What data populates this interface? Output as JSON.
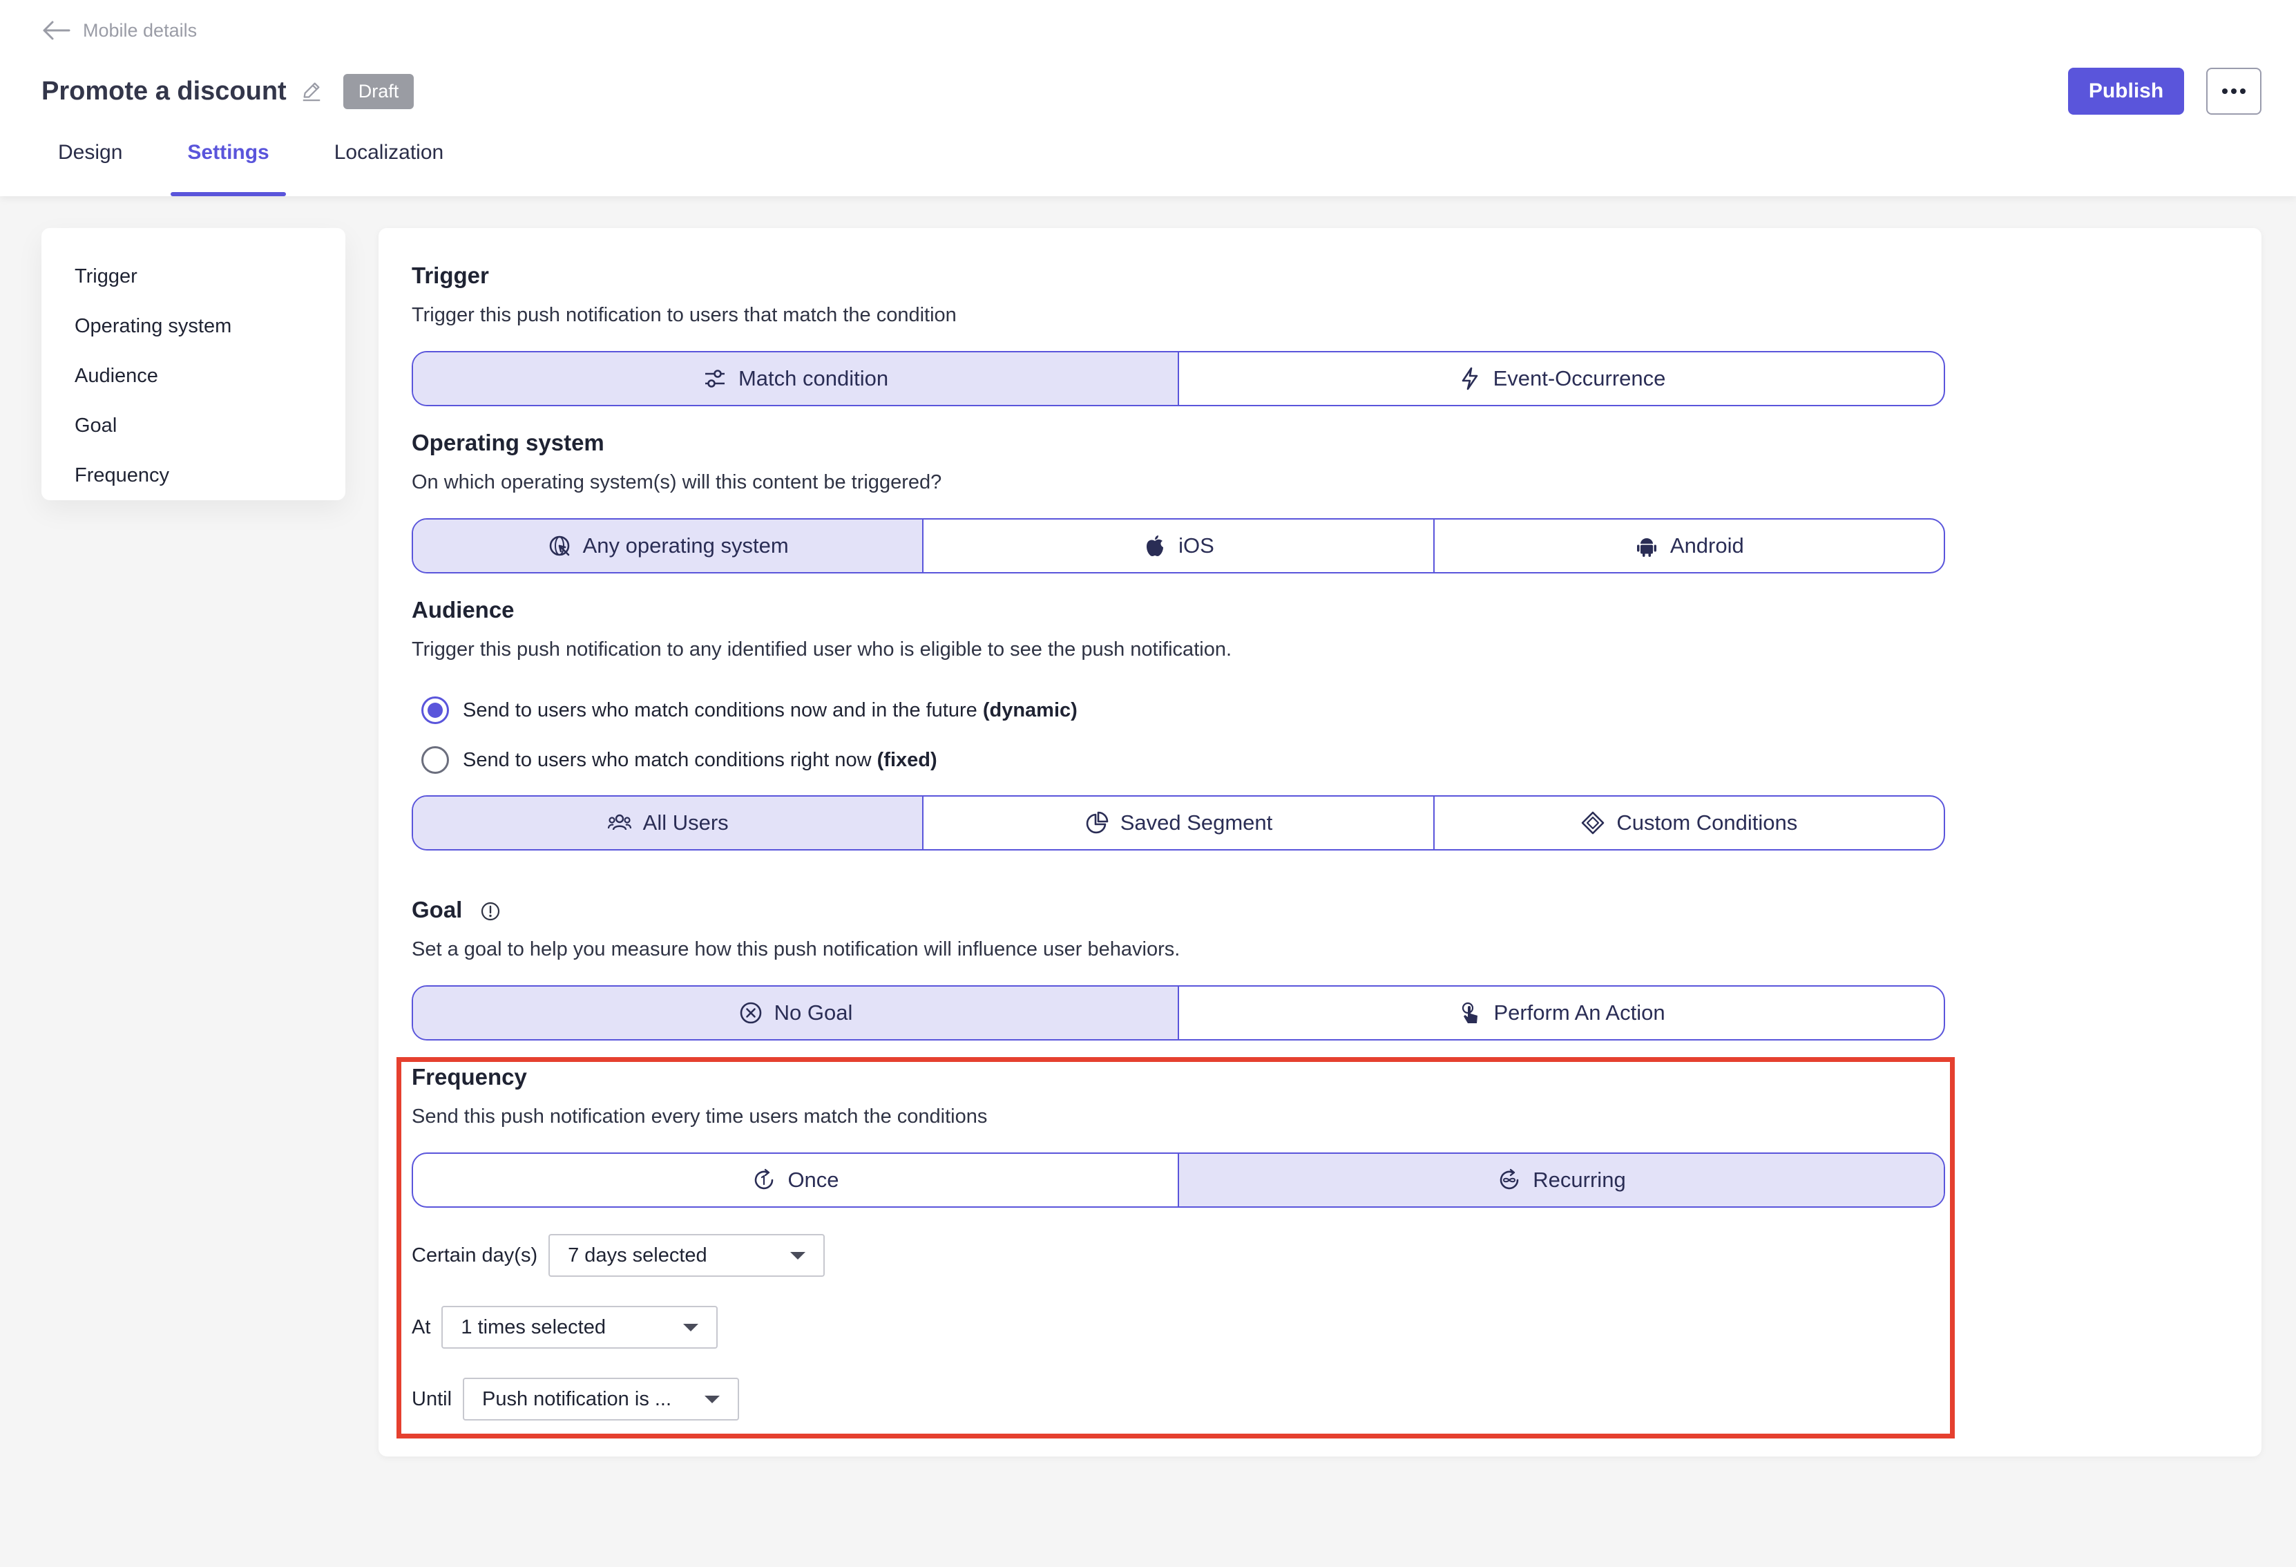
{
  "header": {
    "back_label": "Mobile details",
    "title": "Promote a discount",
    "status_badge": "Draft",
    "publish_label": "Publish",
    "more_icon": "more-horizontal-icon"
  },
  "tabs": [
    {
      "label": "Design",
      "active": false
    },
    {
      "label": "Settings",
      "active": true
    },
    {
      "label": "Localization",
      "active": false
    }
  ],
  "sidenav": {
    "items": [
      "Trigger",
      "Operating system",
      "Audience",
      "Goal",
      "Frequency"
    ]
  },
  "trigger": {
    "title": "Trigger",
    "description": "Trigger this push notification to users that match the condition",
    "options": [
      {
        "label": "Match condition",
        "icon": "sliders-icon",
        "selected": true
      },
      {
        "label": "Event-Occurrence",
        "icon": "lightning-icon",
        "selected": false
      }
    ]
  },
  "os": {
    "title": "Operating system",
    "description": "On which operating system(s) will this content be triggered?",
    "options": [
      {
        "label": "Any operating system",
        "icon": "globe-pointer-icon",
        "selected": true
      },
      {
        "label": "iOS",
        "icon": "apple-icon",
        "selected": false
      },
      {
        "label": "Android",
        "icon": "android-icon",
        "selected": false
      }
    ]
  },
  "audience": {
    "title": "Audience",
    "description": "Trigger this push notification to any identified user who is eligible to see the push notification.",
    "radio_dynamic": {
      "text": "Send to users who match conditions now and in the future ",
      "bold": "(dynamic)",
      "checked": true
    },
    "radio_fixed": {
      "text": "Send to users who match conditions right now ",
      "bold": "(fixed)",
      "checked": false
    },
    "options": [
      {
        "label": "All Users",
        "icon": "users-icon",
        "selected": true
      },
      {
        "label": "Saved Segment",
        "icon": "pie-chart-icon",
        "selected": false
      },
      {
        "label": "Custom Conditions",
        "icon": "diamond-icon",
        "selected": false
      }
    ]
  },
  "goal": {
    "title": "Goal",
    "info_icon": "info-icon",
    "description": "Set a goal to help you measure how this push notification will influence user behaviors.",
    "options": [
      {
        "label": "No Goal",
        "icon": "x-circle-icon",
        "selected": true
      },
      {
        "label": "Perform An Action",
        "icon": "tap-icon",
        "selected": false
      }
    ]
  },
  "frequency": {
    "title": "Frequency",
    "description": "Send this push notification every time users match the conditions",
    "options": [
      {
        "label": "Once",
        "icon": "once-icon",
        "selected": false
      },
      {
        "label": "Recurring",
        "icon": "recurring-icon",
        "selected": true
      }
    ],
    "days_label": "Certain day(s)",
    "days_value": "7 days selected",
    "at_label": "At",
    "at_value": "1 times selected",
    "until_label": "Until",
    "until_value": "Push notification is ..."
  },
  "colors": {
    "accent": "#5a55db",
    "selected_bg": "#e3e2f8",
    "highlight": "#e5402f",
    "badge": "#9a9ca3"
  }
}
